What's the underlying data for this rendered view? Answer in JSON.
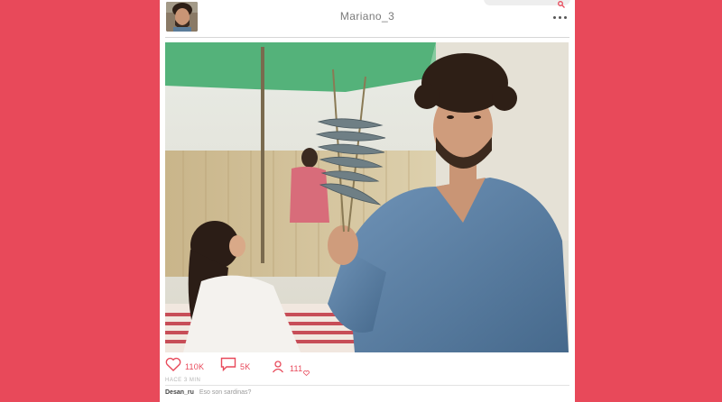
{
  "post": {
    "username": "Mariano_3",
    "time_label": "HACE 3 MIN"
  },
  "actions": {
    "likes": "110K",
    "comments": "5K",
    "followers": "111"
  },
  "comment": {
    "author": "Desan_ru",
    "text": "Eso son sardinas?"
  },
  "colors": {
    "background": "#e8495a",
    "accent": "#e8495a",
    "card": "#ffffff"
  },
  "icons": [
    "search-icon",
    "more-icon",
    "heart-icon",
    "comment-icon",
    "follower-heart-icon"
  ]
}
